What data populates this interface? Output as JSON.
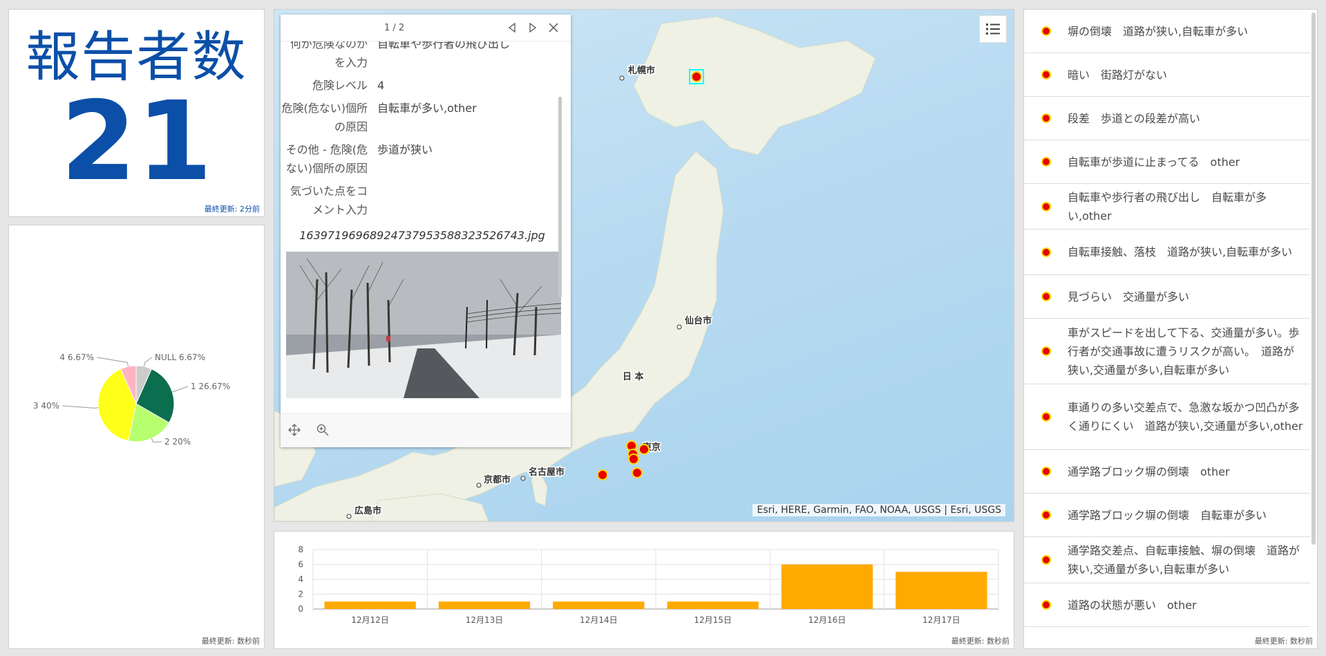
{
  "indicator": {
    "title": "報告者数",
    "value": "21",
    "updated": "最終更新: 2分前"
  },
  "pie": {
    "updated": "最終更新: 数秒前"
  },
  "map": {
    "cities": [
      "札幌市",
      "仙台市",
      "日 本",
      "東京",
      "名古屋市",
      "京都市",
      "広島市"
    ],
    "attribution": "Esri, HERE, Garmin, FAO, NOAA, USGS | Esri, USGS",
    "legend_icon": "legend-list-icon",
    "popup": {
      "count": "1 / 2",
      "fields": [
        {
          "key": "何が危険なのかを入力",
          "value": "自転車や歩行者の飛び出し"
        },
        {
          "key": "危険レベル",
          "value": "4"
        },
        {
          "key": "危険(危ない)個所の原因",
          "value": "自転車が多い,other"
        },
        {
          "key": "その他 - 危険(危ない)個所の原因",
          "value": "歩道が狭い"
        },
        {
          "key": "気づいた点をコメント入力",
          "value": ""
        }
      ],
      "attachment_name": "1639719696892473795358832352674​3.jpg"
    }
  },
  "bar": {
    "updated": "最終更新: 数秒前"
  },
  "list": {
    "updated": "最終更新: 数秒前",
    "marker_color": "#e60000",
    "items": [
      "塀の倒壊　道路が狭い,自転車が多い",
      "暗い　街路灯がない",
      "段差　歩道との段差が高い",
      "自転車が歩道に止まってる　other",
      "自転車や歩行者の飛び出し　自転車が多い,other",
      "自転車接触、落枝　道路が狭い,自転車が多い",
      "見づらい　交通量が多い",
      "車がスピードを出して下る、交通量が多い。歩行者が交通事故に遭うリスクが高い。　道路が狭い,交通量が多い,自転車が多い",
      "車通りの多い交差点で、急激な坂かつ凹凸が多く通りにくい　道路が狭い,交通量が多い,other",
      "通学路ブロック塀の倒壊　other",
      "通学路ブロック塀の倒壊　自転車が多い",
      "通学路交差点、自転車接触、塀の倒壊　道路が狭い,交通量が多い,自転車が多い",
      "道路の状態が悪い　other"
    ]
  },
  "chart_data": [
    {
      "type": "pie",
      "labels": [
        "1 26.67%",
        "2 20%",
        "3 40%",
        "4 6.67%",
        "NULL 6.67%"
      ],
      "categories": [
        "1",
        "2",
        "3",
        "4",
        "NULL"
      ],
      "values": [
        26.67,
        20,
        40,
        6.67,
        6.67
      ],
      "colors": [
        "#0b6e4f",
        "#b6ff6e",
        "#ffff1a",
        "#ffb3c1",
        "#cccccc"
      ]
    },
    {
      "type": "bar",
      "categories": [
        "12月12日",
        "12月13日",
        "12月14日",
        "12月15日",
        "12月16日",
        "12月17日"
      ],
      "values": [
        1,
        1,
        1,
        1,
        6,
        5
      ],
      "ylim": [
        0,
        8
      ],
      "yticks": [
        0,
        2,
        4,
        6,
        8
      ],
      "color": "#ffaa00"
    }
  ]
}
